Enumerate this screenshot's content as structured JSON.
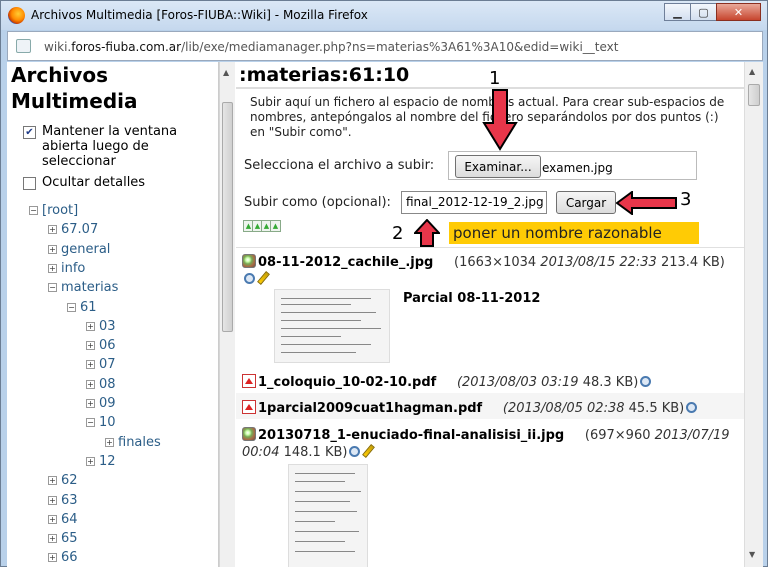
{
  "window": {
    "title": "Archivos Multimedia [Foros-FIUBA::Wiki] - Mozilla Firefox",
    "url_prefix": "wiki.",
    "url_domain": "foros-fiuba.com.ar",
    "url_path": "/lib/exe/mediamanager.php?ns=materias%3A61%3A10&edid=wiki__text"
  },
  "sidebar": {
    "heading": "Archivos Multimedia",
    "keep_window_label": "Mantener la ventana abierta luego de seleccionar",
    "keep_window_checked": true,
    "hide_details_label": "Ocultar detalles",
    "hide_details_checked": false,
    "tree": [
      {
        "label": "[root]",
        "expanded": true
      },
      {
        "label": "67.07",
        "expanded": false
      },
      {
        "label": "general",
        "expanded": false
      },
      {
        "label": "info",
        "expanded": false
      },
      {
        "label": "materias",
        "expanded": true
      },
      {
        "label": "61",
        "expanded": true
      },
      {
        "label": "03",
        "expanded": false
      },
      {
        "label": "06",
        "expanded": false
      },
      {
        "label": "07",
        "expanded": false
      },
      {
        "label": "08",
        "expanded": false
      },
      {
        "label": "09",
        "expanded": false
      },
      {
        "label": "10",
        "expanded": true
      },
      {
        "label": "finales",
        "expanded": false
      },
      {
        "label": "12",
        "expanded": false
      },
      {
        "label": "62",
        "expanded": false
      },
      {
        "label": "63",
        "expanded": false
      },
      {
        "label": "64",
        "expanded": false
      },
      {
        "label": "65",
        "expanded": false
      },
      {
        "label": "66",
        "expanded": false
      }
    ]
  },
  "main": {
    "heading": ":materias:61:10",
    "intro": "Subir aquí un fichero al espacio de nombres actual. Para crear sub-espacios de nombres, antepóngalos al nombre del fichero separándolos por dos puntos (:) en \"Subir como\".",
    "select_label": "Selecciona el archivo a subir:",
    "browse_button": "Examinar...",
    "selected_file": "examen.jpg",
    "upload_as_label": "Subir como (opcional):",
    "upload_as_value": "final_2012-12-19_2.jpg",
    "upload_button": "Cargar",
    "annotation_hint": "poner un nombre razonable",
    "annotation_numbers": [
      "1",
      "2",
      "3"
    ],
    "files": [
      {
        "name": "08-11-2012_cachile_.jpg",
        "dims": "(1663×1034",
        "date": "2013/08/15 22:33",
        "size": "213.4 KB)",
        "caption": "Parcial 08-11-2012"
      },
      {
        "name": "1_coloquio_10-02-10.pdf",
        "date": "(2013/08/03 03:19",
        "size": "48.3 KB)"
      },
      {
        "name": "1parcial2009cuat1hagman.pdf",
        "date": "(2013/08/05 02:38",
        "size": "45.5 KB)"
      },
      {
        "name": "20130718_1-enuciado-final-analisisi_ii.jpg",
        "dims": "(697×960",
        "date": "2013/07/19 00:04",
        "size": "148.1 KB)"
      }
    ]
  },
  "colors": {
    "accent_arrow": "#e8364a",
    "hint_bg": "#ffcb05",
    "link": "#2b5d87"
  }
}
